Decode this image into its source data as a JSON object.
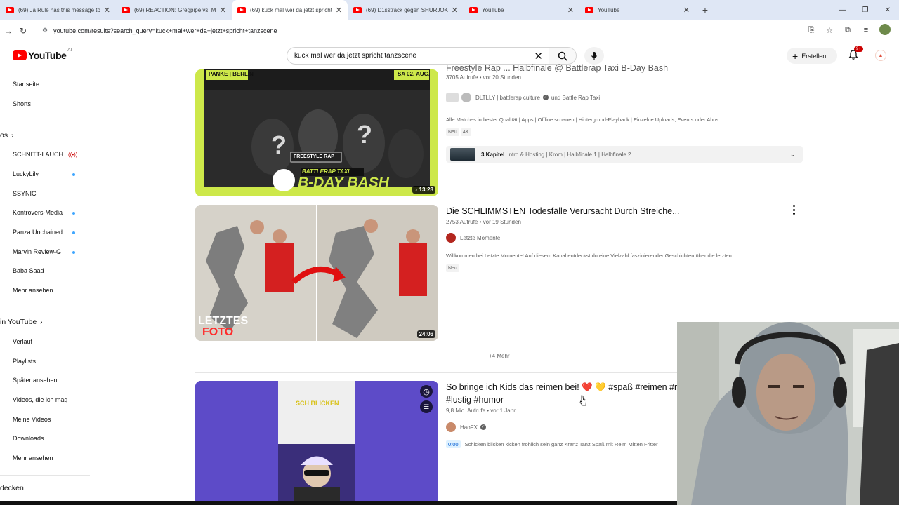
{
  "browser": {
    "tabs": [
      {
        "title": "(69) Ja Rule has this message to",
        "active": false
      },
      {
        "title": "(69) REACTION: Gregpipe vs. M",
        "active": false
      },
      {
        "title": "(69) kuck mal wer da jetzt spricht",
        "active": true
      },
      {
        "title": "(69) D1sstrack gegen SHURJOK",
        "active": false
      },
      {
        "title": "YouTube",
        "active": false
      },
      {
        "title": "YouTube",
        "active": false
      }
    ],
    "url": "youtube.com/results?search_query=kuck+mal+wer+da+jetzt+spricht+tanzscene"
  },
  "masthead": {
    "logo_text": "YouTube",
    "country_code": "AT",
    "search_value": "kuck mal wer da jetzt spricht tanzscene",
    "create_label": "Erstellen",
    "notification_count": "9+"
  },
  "sidebar": {
    "top_items": [
      "Startseite",
      "Shorts"
    ],
    "subscriptions_heading": "os",
    "subscriptions": [
      "SCHNITT-LAUCH...",
      "LuckyLily",
      "SSYNIC",
      "Kontrovers-Media",
      "Panza Unchained",
      "Marvin Review-G",
      "Baba Saad",
      "Mehr ansehen"
    ],
    "you_heading": "in YouTube",
    "you_items": [
      "Verlauf",
      "Playlists",
      "Später ansehen",
      "Videos, die ich mag",
      "Meine Videos",
      "Downloads",
      "Mehr ansehen"
    ],
    "explore_heading": "decken"
  },
  "results": [
    {
      "title": "Freestyle Rap ... Halbfinale @ Battlerap Taxi B-Day Bash",
      "views": "3705 Aufrufe",
      "age": "vor 20 Stunden",
      "channel": "DLTLLY | battlerap culture",
      "channel_extra": "und Battle Rap Taxi",
      "description": "Alle Matches in bester Qualität | Apps | Offline schauen | Hintergrund-Playback | Einzelne Uploads, Events oder Abos ...",
      "badges": [
        "Neu",
        "4K"
      ],
      "duration": "13:28",
      "chapters_count": "3 Kapitel",
      "chapters_text": "Intro & Hosting | Krom | Halbfinale 1 | Halbfinale 2",
      "thumb_text": {
        "top_left": "PANKE | BERLIN",
        "top_right": "SA 02. AUG.",
        "freestyle": "FREESTYLE RAP",
        "taxi": "BATTLERAP TAXI",
        "bash": "B-DAY BASH"
      }
    },
    {
      "title": "Die SCHLIMMSTEN Todesfälle Verursacht Durch Streiche...",
      "views": "2753 Aufrufe",
      "age": "vor 19 Stunden",
      "channel": "Letzte Momente",
      "description": "Willkommen bei Letzte Momente! Auf diesem Kanal entdeckst du eine Vielzahl faszinierender Geschichten über die letzten ...",
      "badges": [
        "Neu"
      ],
      "duration": "24:06",
      "thumb_text": {
        "line1": "LETZTES",
        "line2": "FOTO"
      }
    },
    {
      "title_line1": "So bringe ich Kids das reimen bei! ❤️ 💛 #spaß #reimen #m",
      "title_line2": "#lustig #humor",
      "views": "9,8 Mio. Aufrufe",
      "age": "vor 1 Jahr",
      "channel": "HaoFX",
      "timestamp": "0:00",
      "description": "Schicken blicken kicken fröhlich sein ganz Kranz Tanz Spaß mit Reim Mitten Fritter",
      "thumb_text": "SCH BLICKEN"
    }
  ],
  "more_link": "+4 Mehr",
  "colors": {
    "brand_red": "#ff0000",
    "link_blue": "#065fd4",
    "tab_bar": "#dfe7f5"
  }
}
